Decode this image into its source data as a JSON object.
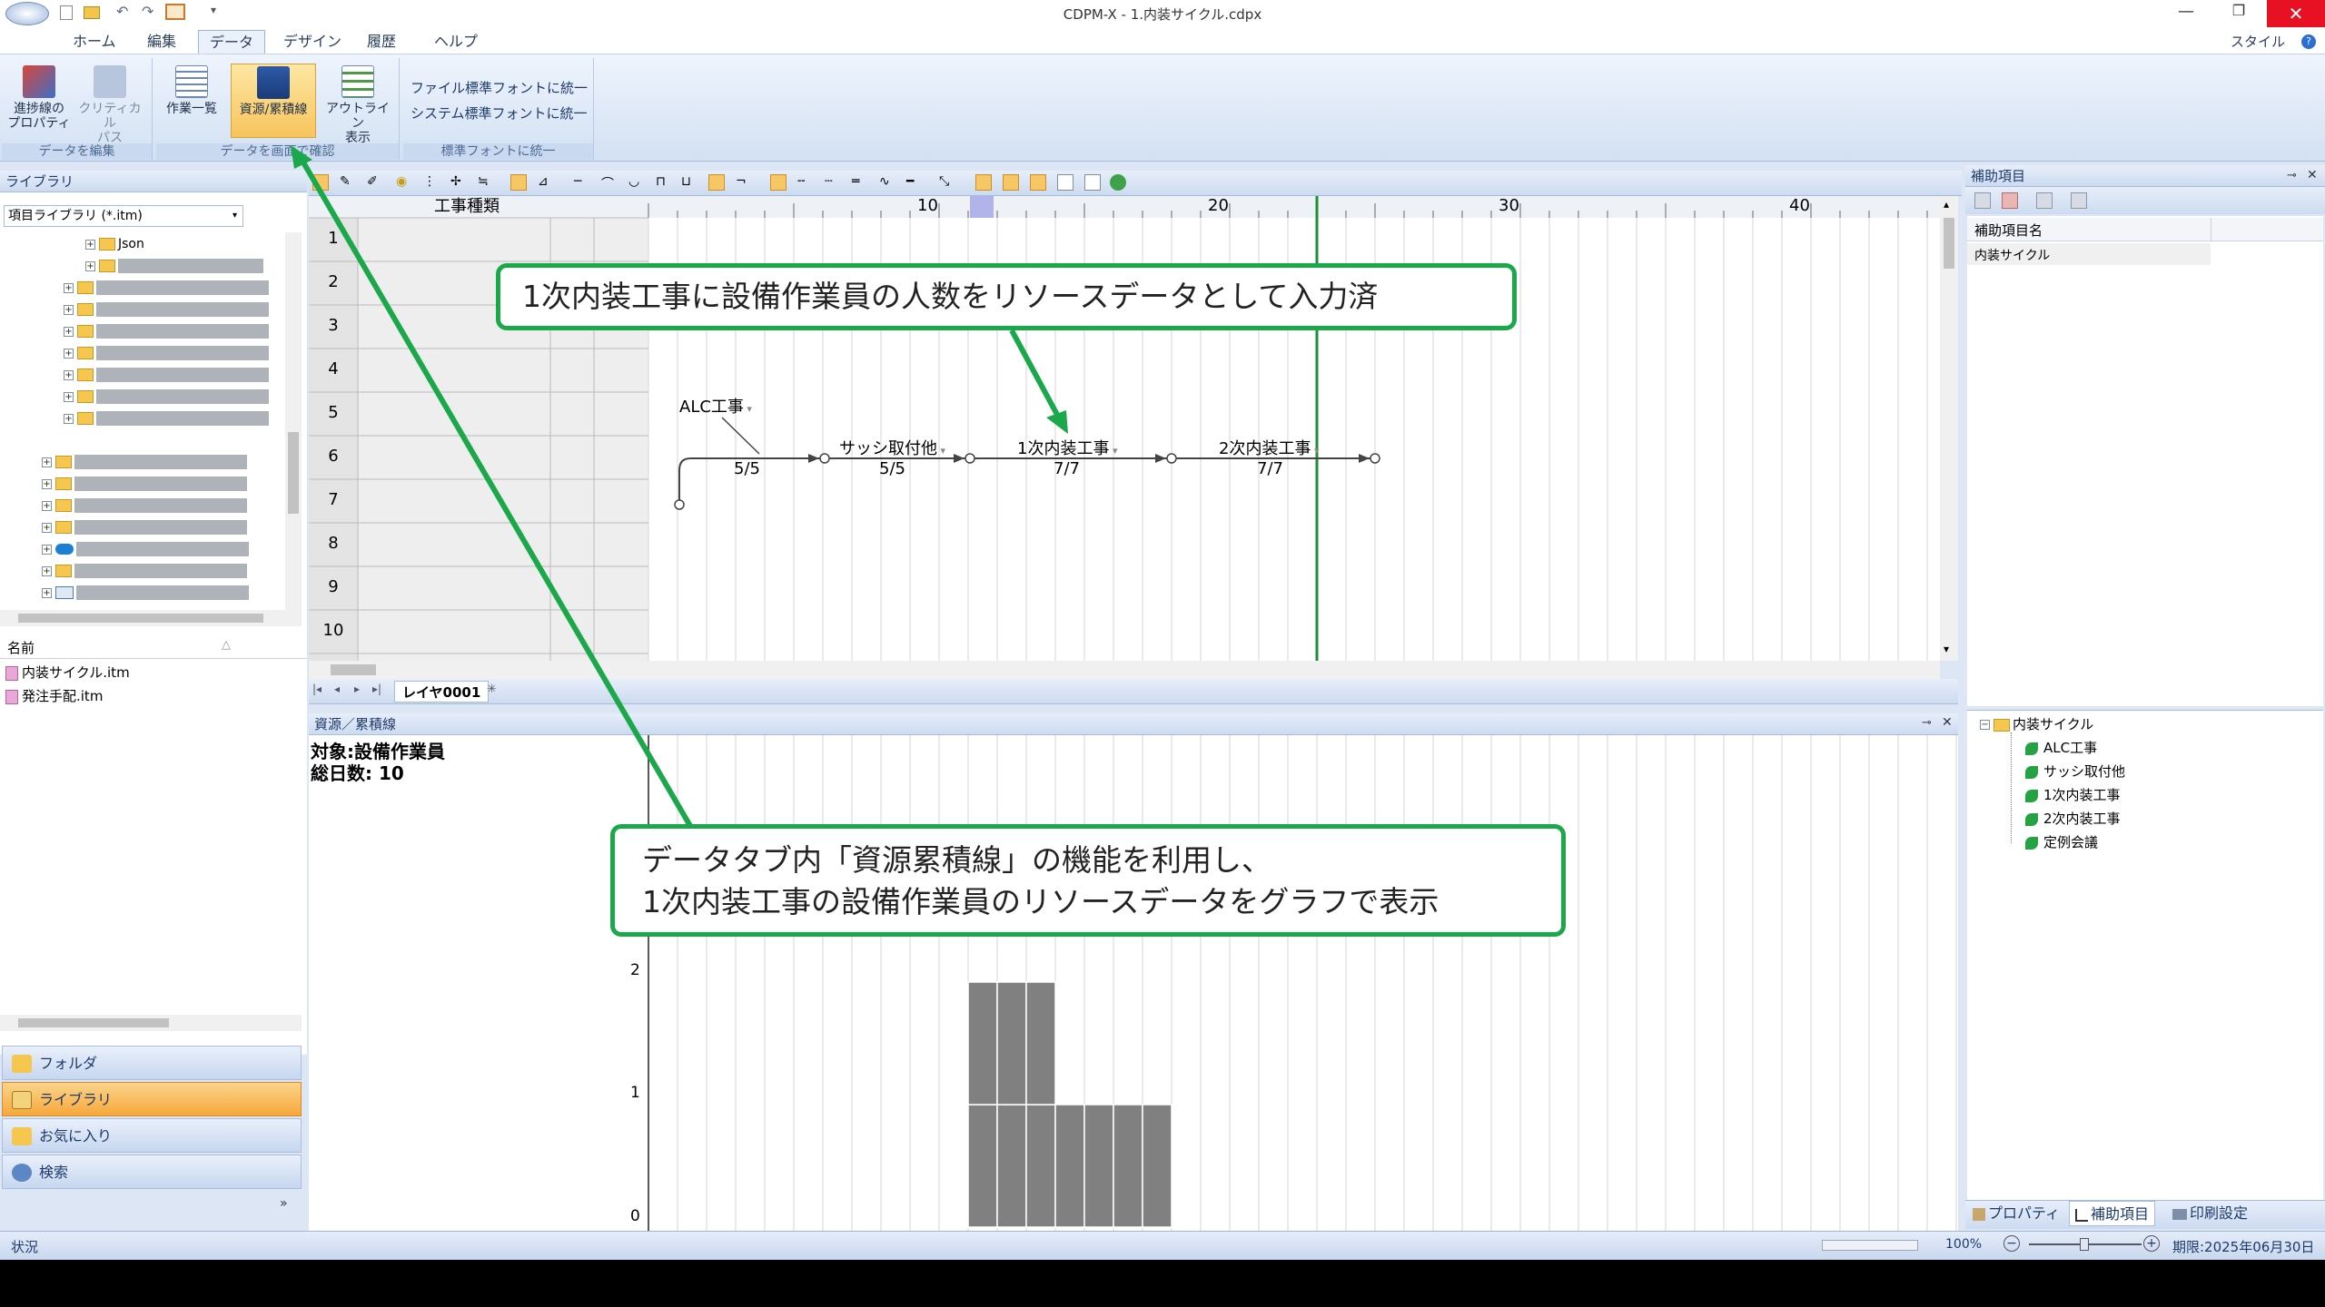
{
  "window": {
    "title": "CDPM-X - 1.内装サイクル.cdpx"
  },
  "menu": {
    "items": [
      "ホーム",
      "編集",
      "データ",
      "デザイン",
      "履歴",
      "ヘルプ"
    ],
    "active": "データ",
    "style_label": "スタイル"
  },
  "ribbon": {
    "group1": {
      "caption": "データを編集",
      "btn1": "進捗線の\nプロパティ",
      "btn2": "クリティカル\nパス"
    },
    "group2": {
      "caption": "データを画面で確認",
      "btn1": "作業一覧",
      "btn2": "資源/累積線",
      "btn3": "アウトライン\n表示"
    },
    "group3": {
      "caption": "標準フォントに統一",
      "btn1": "ファイル標準フォントに統一",
      "btn2": "システム標準フォントに統一"
    }
  },
  "library": {
    "title": "ライブラリ",
    "dropdown": "項目ライブラリ (*.itm)",
    "tree_first": "Json",
    "name_header": "名前",
    "files": [
      "内装サイクル.itm",
      "発注手配.itm"
    ]
  },
  "nav": {
    "items": [
      "フォルダ",
      "ライブラリ",
      "お気に入り",
      "検索"
    ],
    "selected": "ライブラリ"
  },
  "network": {
    "column_header": "工事種類",
    "ruler": [
      "10",
      "20",
      "30",
      "40"
    ],
    "rows": [
      "1",
      "2",
      "3",
      "4",
      "5",
      "6",
      "7",
      "8",
      "9",
      "10"
    ],
    "activities": [
      {
        "name": "ALC工事",
        "value": "5/5"
      },
      {
        "name": "サッシ取付他",
        "value": "5/5"
      },
      {
        "name": "1次内装工事",
        "value": "7/7"
      },
      {
        "name": "2次内装工事",
        "value": "7/7"
      }
    ],
    "layer_tab": "レイヤ0001"
  },
  "resource": {
    "title": "資源／累積線",
    "target": "対象:設備作業員",
    "total_days": "総日数: 10",
    "y_ticks": [
      "2",
      "1",
      "0"
    ]
  },
  "chart_data": {
    "type": "bar",
    "title": "",
    "xlabel": "",
    "ylabel": "",
    "x": [
      12,
      13,
      14,
      15,
      16,
      17,
      18
    ],
    "values": [
      2,
      2,
      2,
      1,
      1,
      1,
      1
    ],
    "ylim": [
      0,
      2
    ]
  },
  "aux": {
    "title": "補助項目",
    "col_header": "補助項目名",
    "row1": "内装サイクル",
    "tree_root": "内装サイクル",
    "tree_items": [
      "ALC工事",
      "サッシ取付他",
      "1次内装工事",
      "2次内装工事",
      "定例会議"
    ]
  },
  "right_tabs": {
    "items": [
      "プロパティ",
      "補助項目",
      "印刷設定"
    ]
  },
  "callouts": {
    "top": "1次内装工事に設備作業員の人数をリソースデータとして入力済",
    "bottom_line1": "データタブ内「資源累積線」の機能を利用し、",
    "bottom_line2": "1次内装工事の設備作業員のリソースデータをグラフで表示"
  },
  "status": {
    "left": "状況",
    "zoom": "100%",
    "deadline": "期限:2025年06月30日"
  },
  "colors": {
    "callout_green": "#1aa84b",
    "bar_gray": "#808080",
    "today_line": "#1f8c3a",
    "nav_selected": "#f6a73a"
  }
}
